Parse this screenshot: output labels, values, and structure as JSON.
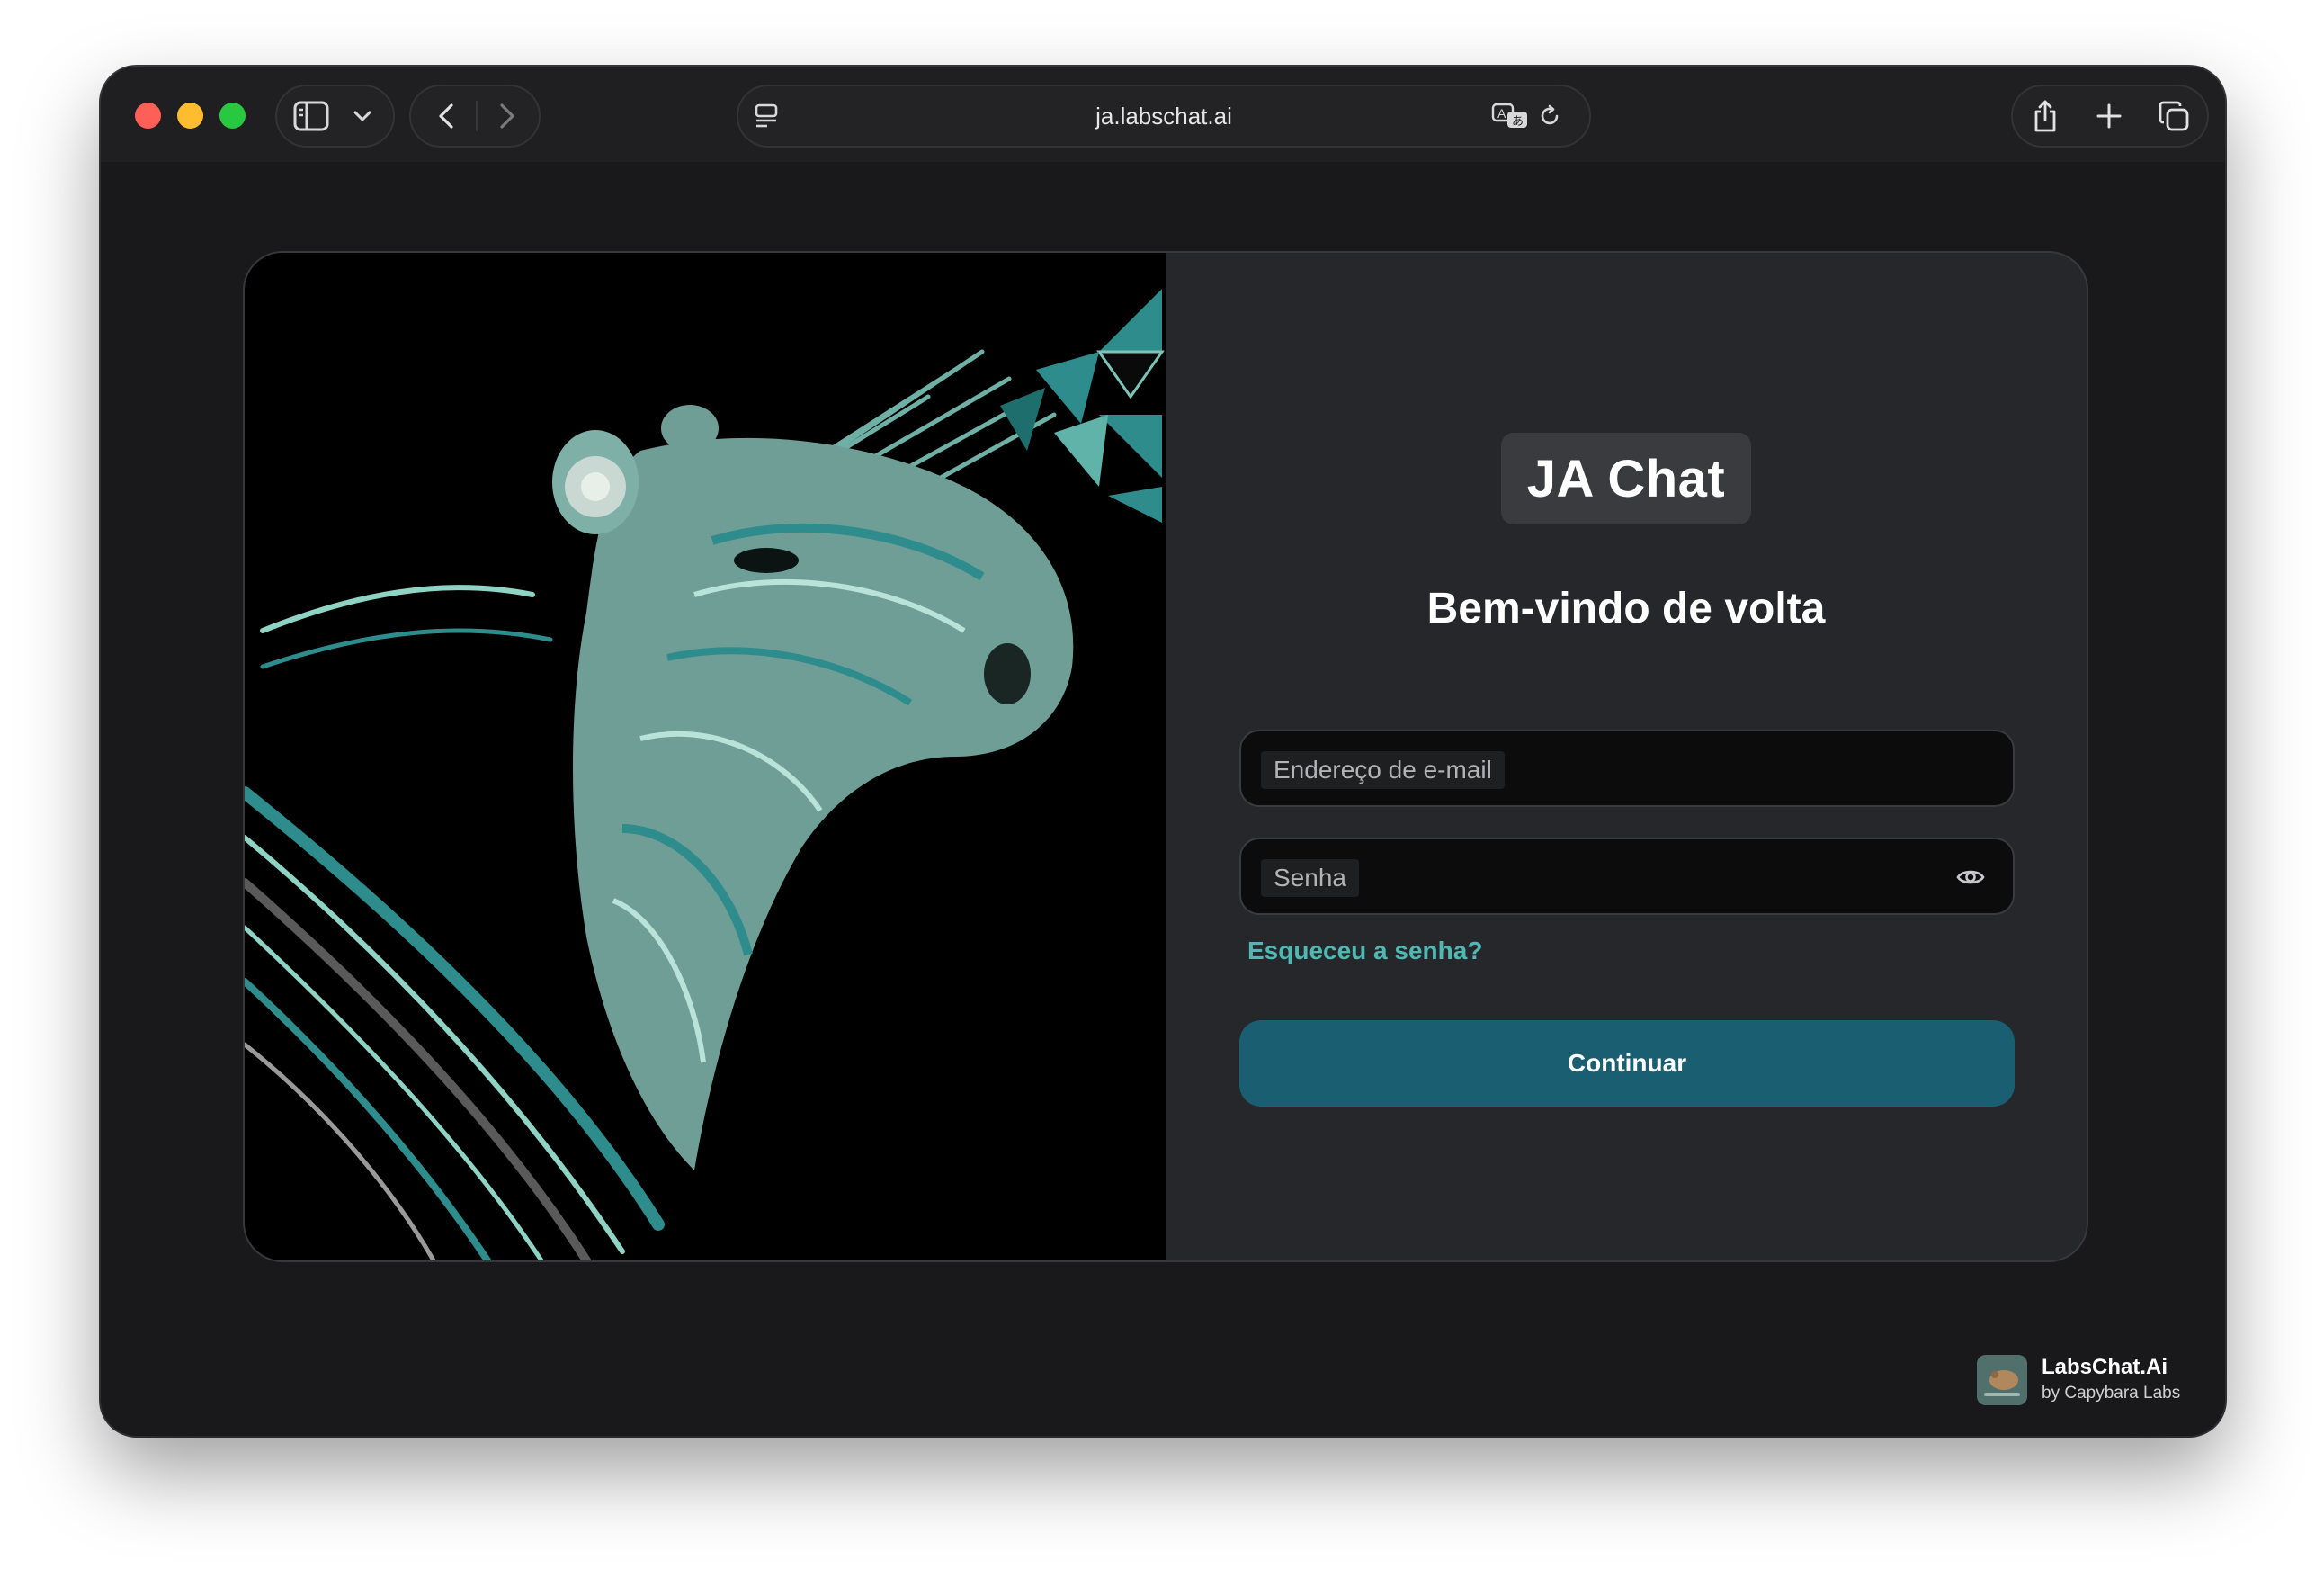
{
  "browser": {
    "url": "ja.labschat.ai"
  },
  "brand": {
    "name": "JA Chat"
  },
  "login": {
    "title": "Bem-vindo de volta",
    "email_label": "Endereço de e-mail",
    "password_label": "Senha",
    "forgot_link": "Esqueceu a senha?",
    "submit_label": "Continuar"
  },
  "footer": {
    "title": "LabsChat.Ai",
    "subtitle": "by Capybara Labs"
  },
  "colors": {
    "window_bg": "#19191b",
    "card_bg": "#26272a",
    "accent_link": "#4fb8b3",
    "button_bg": "#1a5e72",
    "art_teal": "#2f8c8c",
    "art_mint": "#8fd3c5"
  },
  "icons": [
    "sidebar-icon",
    "chevron-down-icon",
    "back-arrow-icon",
    "forward-arrow-icon",
    "page-menu-icon",
    "translate-icon",
    "reload-icon",
    "share-icon",
    "plus-icon",
    "tabs-overview-icon",
    "eye-icon"
  ]
}
